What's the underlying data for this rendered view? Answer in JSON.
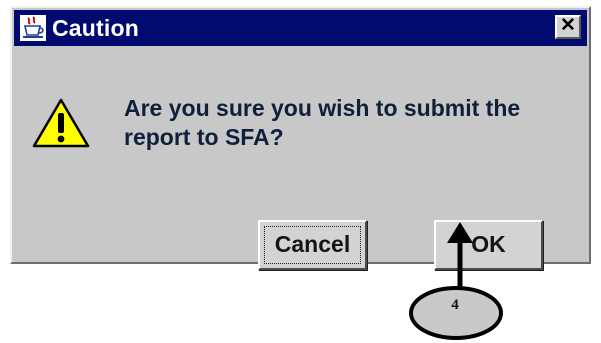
{
  "dialog": {
    "title": "Caution",
    "close_glyph": "✕",
    "message_line1": "Are you sure you wish to submit the",
    "message_line2": "report to SFA?",
    "buttons": {
      "cancel_label": "Cancel",
      "ok_label": "OK"
    },
    "icons": {
      "app": "java-cup-icon",
      "warning": "warning-triangle-icon",
      "close": "close-icon"
    }
  },
  "annotation": {
    "step_number": "4",
    "arrow_target": "ok-button"
  },
  "colors": {
    "titlebar": "#000a6f",
    "window": "#c8c8c8",
    "warning_fill": "#ffff00",
    "text": "#10203a"
  }
}
